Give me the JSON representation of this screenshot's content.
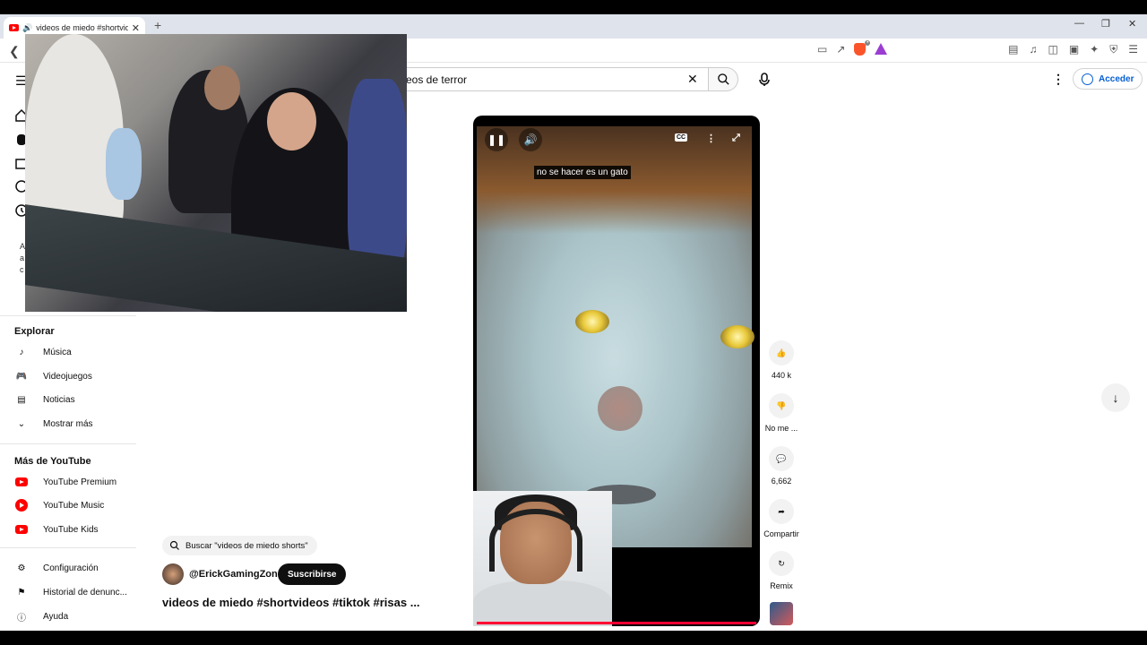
{
  "browser": {
    "tab_title": "videos de miedo #shortvideos",
    "tab_close": "✕",
    "new_tab": "+",
    "window_controls": [
      "—",
      "❐",
      "✕"
    ]
  },
  "header": {
    "search_value": "eos de terror",
    "signin_label": "Acceder"
  },
  "sidebar": {
    "explore_heading": "Explorar",
    "explore_items": [
      {
        "label": "Música",
        "icon": "music-note-icon"
      },
      {
        "label": "Videojuegos",
        "icon": "gamepad-icon"
      },
      {
        "label": "Noticias",
        "icon": "newspaper-icon"
      },
      {
        "label": "Mostrar más",
        "icon": "chevron-down-icon"
      }
    ],
    "more_heading": "Más de YouTube",
    "more_items": [
      {
        "label": "YouTube Premium"
      },
      {
        "label": "YouTube Music"
      },
      {
        "label": "YouTube Kids"
      }
    ],
    "settings_items": [
      {
        "label": "Configuración",
        "icon": "gear-icon"
      },
      {
        "label": "Historial de denunc...",
        "icon": "flag-icon"
      },
      {
        "label": "Ayuda",
        "icon": "help-icon"
      }
    ],
    "peek_lines": [
      "A",
      "a",
      "c"
    ]
  },
  "player": {
    "subtitle": "no se hacer es un gato",
    "progress": 1.0
  },
  "actions": {
    "like_count": "440 k",
    "dislike_label": "No me ...",
    "comment_count": "6,662",
    "share_label": "Compartir",
    "remix_label": "Remix"
  },
  "info": {
    "search_chip": "Buscar \"videos de miedo shorts\"",
    "channel_handle": "@ErickGamingZone",
    "subscribe_label": "Suscribirse",
    "video_title": "videos de miedo #shortvideos #tiktok #risas ..."
  },
  "colors": {
    "accent": "#ff0033",
    "link": "#065fd4"
  }
}
